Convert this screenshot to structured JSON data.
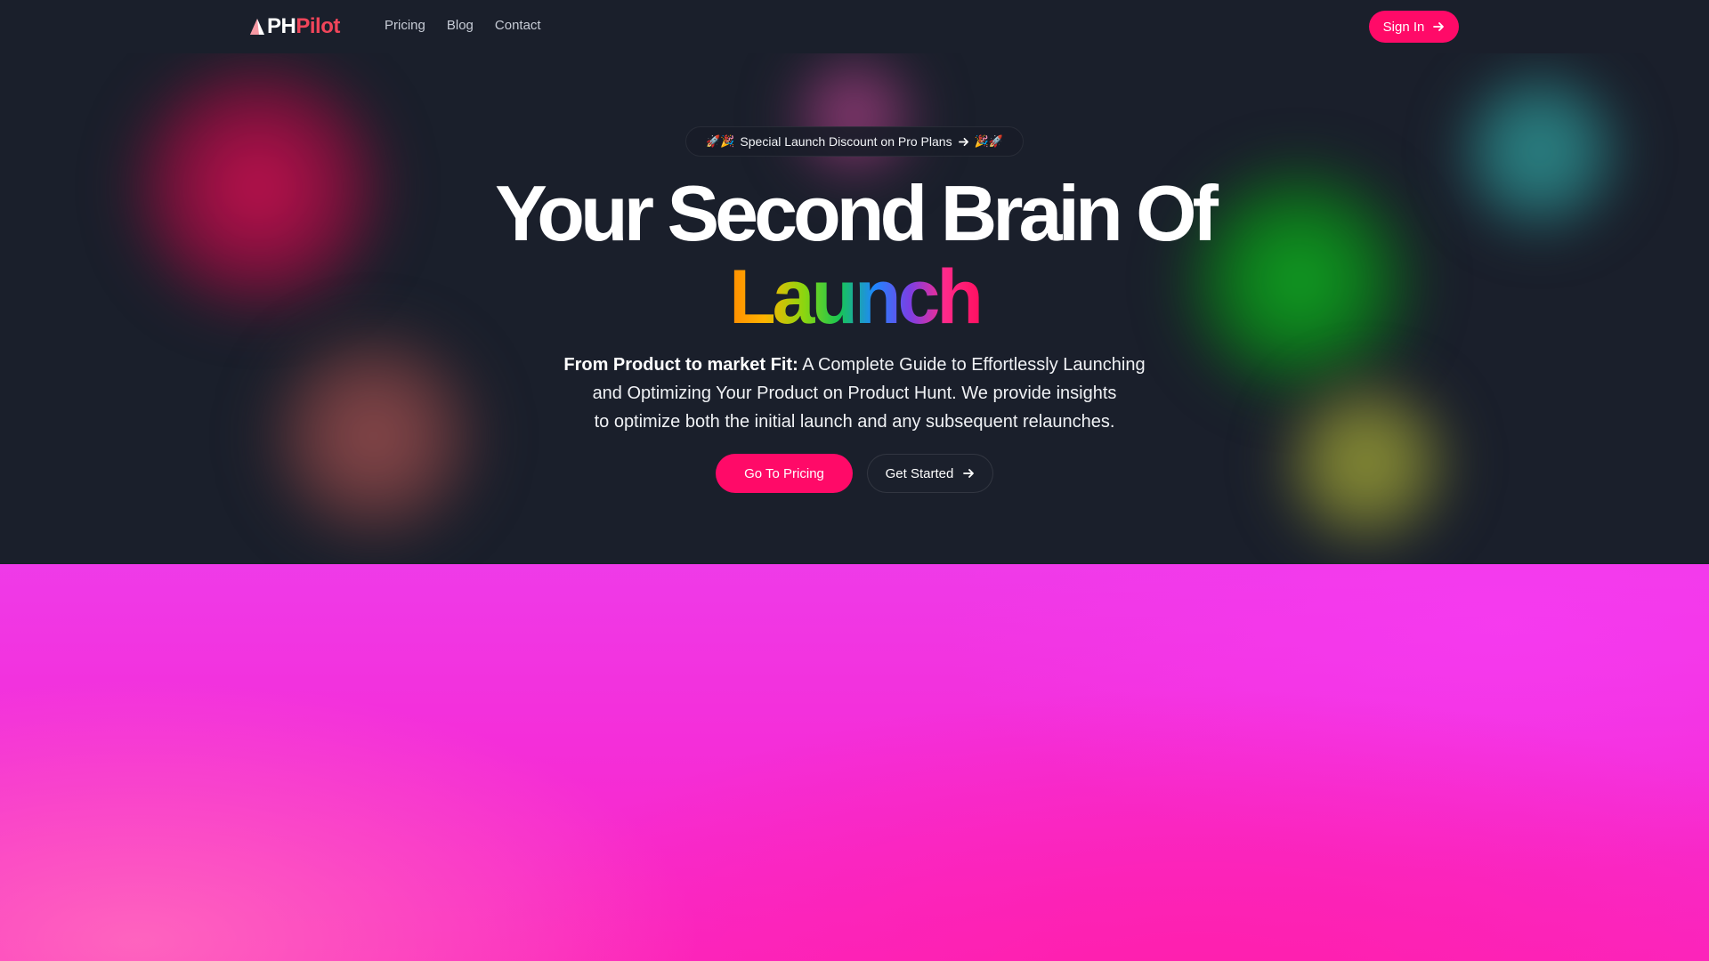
{
  "brand": {
    "name_ph": "PH",
    "name_pilot": "Pilot"
  },
  "nav": {
    "links": [
      "Pricing",
      "Blog",
      "Contact"
    ],
    "signin_label": "Sign In"
  },
  "promo": {
    "emoji_left": "🚀🎉",
    "label": "Special Launch Discount on Pro Plans",
    "emoji_right": "🎉🚀"
  },
  "hero": {
    "headline_line1": "Your Second Brain Of",
    "headline_line2": "Launch",
    "description_bold": "From Product to market Fit:",
    "description_line1": " A Complete Guide to Effortlessly Launching",
    "description_line2": "and Optimizing Your Product on Product Hunt. We provide insights",
    "description_line3": "to optimize both the initial launch and any subsequent relaunches.",
    "cta_primary": "Go To Pricing",
    "cta_secondary": "Get Started"
  },
  "colors": {
    "accent": "#ff0a68",
    "background": "#1a1f2b",
    "logo_accent": "#f0455a",
    "pink_section": "#f42ed9"
  },
  "icons": {
    "logo": "triangle-logo-icon",
    "signin": "arrow-right-icon",
    "promo": "arrow-right-icon",
    "cta_secondary": "arrow-right-icon"
  }
}
